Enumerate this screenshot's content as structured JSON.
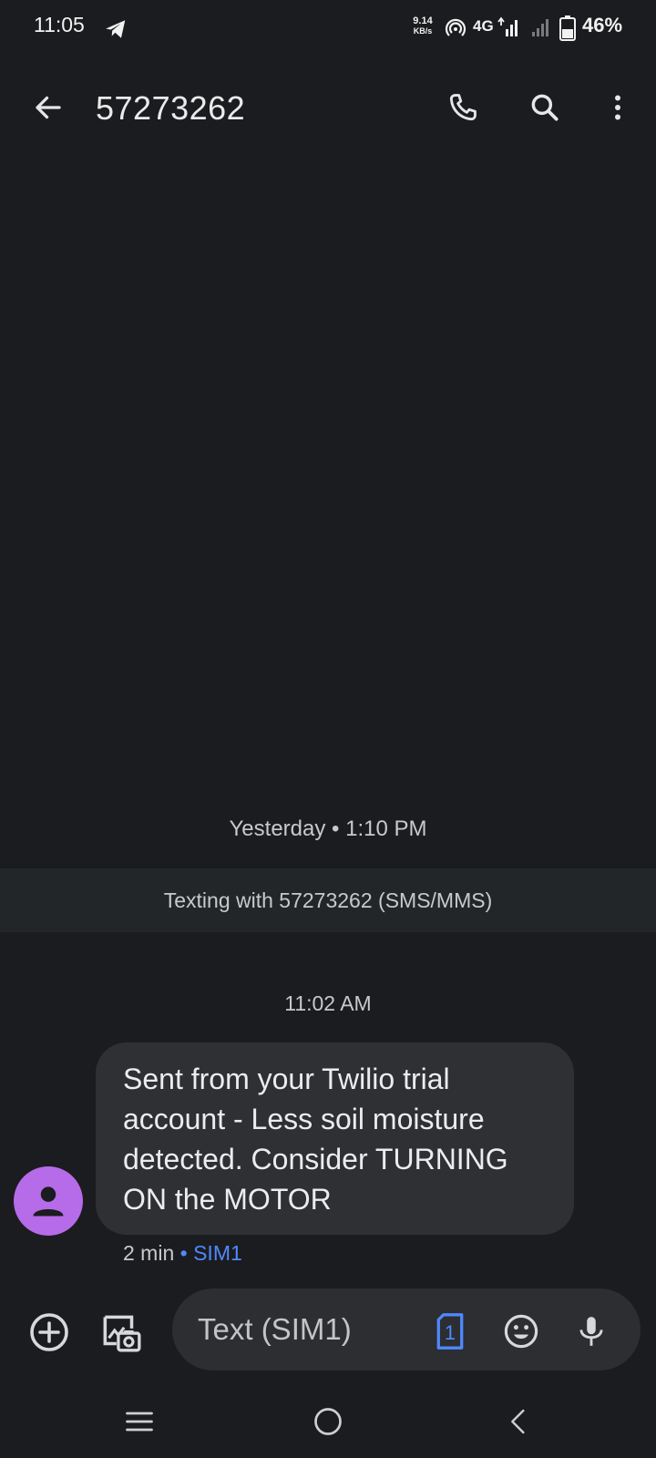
{
  "status_bar": {
    "time": "11:05",
    "net_speed_value": "9.14",
    "net_speed_unit": "KB/s",
    "network_type": "4G",
    "battery_percent": "46%"
  },
  "app_bar": {
    "title": "57273262"
  },
  "conversation": {
    "date_separator": "Yesterday • 1:10 PM",
    "texting_banner": "Texting with 57273262 (SMS/MMS)",
    "message_time": "11:02 AM",
    "messages": [
      {
        "text": "Sent from your Twilio trial account - Less soil moisture detected. Consider TURNING ON the MOTOR",
        "age": "2 min",
        "sim": "• SIM1"
      }
    ]
  },
  "compose": {
    "placeholder": "Text (SIM1)",
    "sim_number": "1"
  },
  "colors": {
    "background": "#1b1c1f",
    "bubble": "#2e3033",
    "avatar": "#b66be9",
    "accent": "#4f88ff"
  }
}
